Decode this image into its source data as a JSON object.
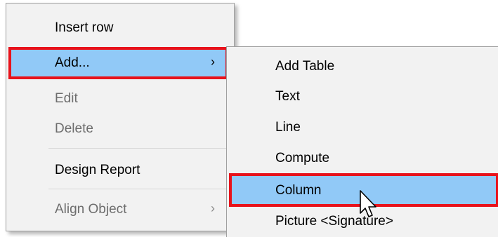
{
  "main_menu": {
    "items": [
      {
        "label": "Insert row",
        "enabled": true,
        "has_submenu": false
      },
      {
        "label": "Add...",
        "enabled": true,
        "has_submenu": true,
        "highlighted": true
      },
      {
        "label": "Edit",
        "enabled": false,
        "has_submenu": false
      },
      {
        "label": "Delete",
        "enabled": false,
        "has_submenu": false
      },
      {
        "label": "Design Report",
        "enabled": true,
        "has_submenu": false
      },
      {
        "label": "Align Object",
        "enabled": false,
        "has_submenu": true
      }
    ],
    "submenu_arrow": "›"
  },
  "sub_menu": {
    "items": [
      {
        "label": "Add Table"
      },
      {
        "label": "Text"
      },
      {
        "label": "Line"
      },
      {
        "label": "Compute"
      },
      {
        "label": "Column",
        "highlighted": true
      },
      {
        "label": "Picture <Signature>"
      }
    ]
  },
  "colors": {
    "menu_bg": "#f2f2f2",
    "highlight": "#91c9f7",
    "annotation_border": "#e8121b",
    "disabled_text": "#6d6d6d"
  },
  "icons": [
    "mouse-pointer-icon",
    "submenu-arrow-icon"
  ]
}
